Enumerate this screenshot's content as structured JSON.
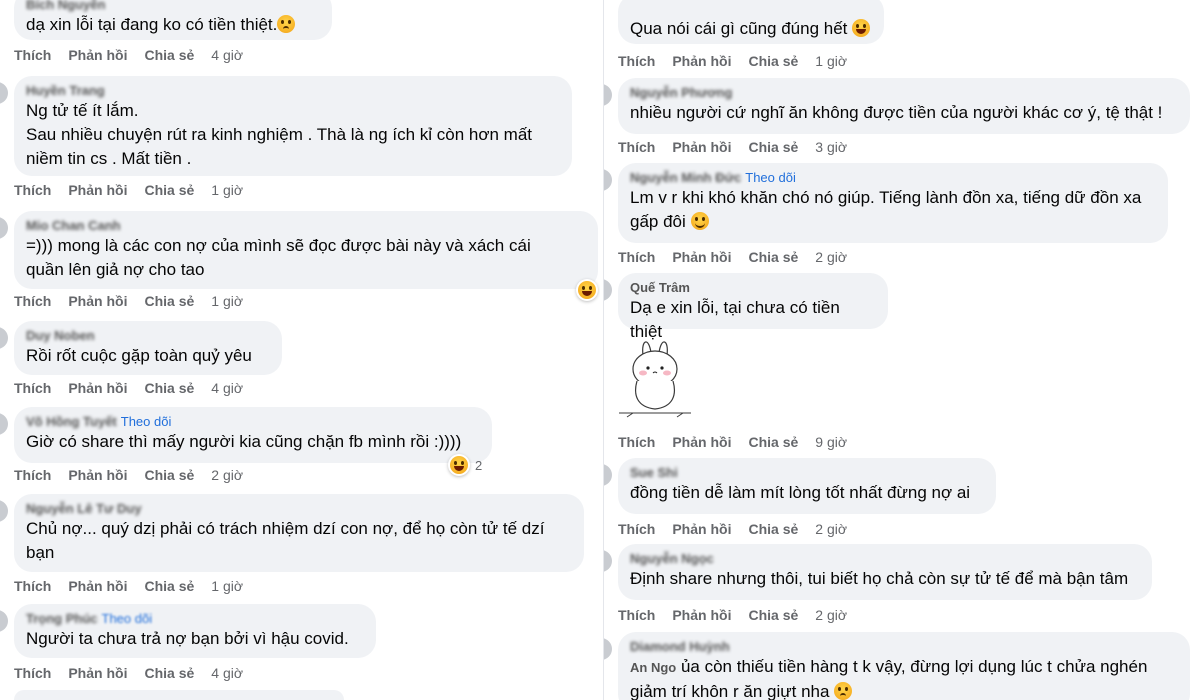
{
  "actions": {
    "like": "Thích",
    "reply": "Phản hồi",
    "share": "Chia sẻ",
    "follow": "Theo dõi"
  },
  "left": [
    {
      "name": "Bích Nguyễn",
      "text": "dạ xin lỗi tại đang ko có tiền thiệt.",
      "emoji": "sad",
      "time": "4 giờ"
    },
    {
      "name": "Huyền Trang",
      "text": "Ng tử tế ít lắm.\nSau nhiều chuyện rút ra kinh nghiệm . Thà là ng ích kỉ còn hơn mất\nniềm tin cs . Mất tiền .",
      "time": "1 giờ"
    },
    {
      "name": "Mio Chan Canh",
      "text": "=))) mong là các con nợ của mình sẽ đọc được bài này và xách cái\nquần lên giả nợ cho tao",
      "time": "1 giờ",
      "reaction": "laugh"
    },
    {
      "name": "Duy Noben",
      "text": "Rồi rốt cuộc gặp toàn quỷ yêu",
      "time": "4 giờ"
    },
    {
      "name": "Võ Hồng Tuyết",
      "follow": true,
      "text": "Giờ có share thì mấy người kia cũng chặn fb mình rồi :))))",
      "time": "2 giờ",
      "reaction": "laugh",
      "reaction_count": "2"
    },
    {
      "name": "Nguyễn Lê Tư Duy",
      "text": "Chủ nợ... quý dzị phải có trách nhiệm dzí con nợ, để họ còn tử tế dzí\nbạn",
      "time": "1 giờ"
    },
    {
      "name": "Trọng Phúc",
      "follow": true,
      "text": "Người ta chưa trả nợ bạn bởi vì hậu covid.",
      "time": "4 giờ"
    }
  ],
  "right": [
    {
      "name": "",
      "text": "Qua nói cái gì cũng đúng hết",
      "emoji": "laugh",
      "time": "1 giờ"
    },
    {
      "name": "Nguyễn Phương",
      "text": "nhiều người cứ nghĩ ăn không được tiền của người khác cơ ý, tệ thật !",
      "time": "3 giờ"
    },
    {
      "name": "Nguyễn Minh Đức",
      "follow": true,
      "text": "Lm v r khi khó khăn chó nó giúp. Tiếng lành đồn xa, tiếng dữ đồn xa\ngấp đôi",
      "emoji": "smile",
      "time": "2 giờ"
    },
    {
      "name": "Quế Trâm",
      "text": "Dạ e xin lỗi, tại chưa có tiền thiệt",
      "time": "9 giờ",
      "sticker": true
    },
    {
      "name": "Sue Shi",
      "text": "đồng tiền dễ làm mít lòng tốt nhất đừng nợ ai",
      "time": "2 giờ"
    },
    {
      "name": "Nguyễn Ngọc",
      "text": "Định share nhưng thôi, tui biết họ chả còn sự tử tế để mà bận tâm",
      "time": "2 giờ"
    },
    {
      "name": "Diamond Huỳnh",
      "mention": "An Ngo",
      "text": "ủa còn thiếu tiền hàng t k vậy, đừng lợi dụng lúc t chửa nghén\ngiảm trí khôn r ăn giựt nha",
      "emoji": "sad",
      "time": ""
    }
  ],
  "colors": {
    "bubble": "#f0f2f5",
    "link": "#216fdb",
    "muted": "#65676b"
  }
}
